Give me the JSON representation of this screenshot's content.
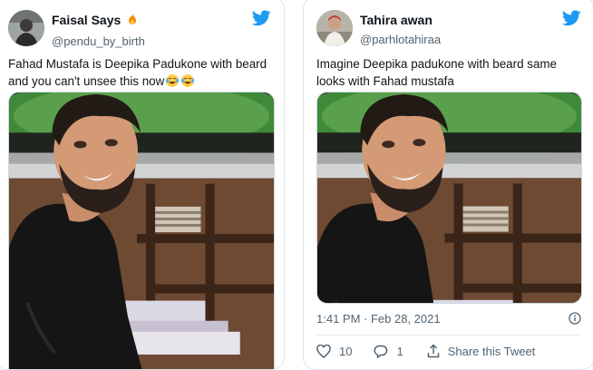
{
  "colors": {
    "twitter_blue": "#1d9bf0",
    "text_primary": "#0f1419",
    "text_secondary": "#536471",
    "border": "#dfe3e6"
  },
  "tweets": [
    {
      "author_name": "Faisal Says",
      "name_emoji_icon": "fire-emoji-icon",
      "handle": "@pendu_by_birth",
      "text": "Fahad Mustafa is Deepika Padukone with beard and you can't unsee this now",
      "text_emoji_icons": [
        "tears-of-joy-emoji-icon",
        "tears-of-joy-emoji-icon"
      ],
      "image_icon": "man-with-beard-photo"
    },
    {
      "author_name": "Tahira awan",
      "handle": "@parhlotahiraa",
      "text": "Imagine Deepika padukone with beard same looks with Fahad mustafa",
      "image_icon": "man-with-beard-photo",
      "timestamp": "1:41 PM · Feb 28, 2021",
      "likes": "10",
      "replies": "1",
      "share_label": "Share this Tweet"
    }
  ]
}
